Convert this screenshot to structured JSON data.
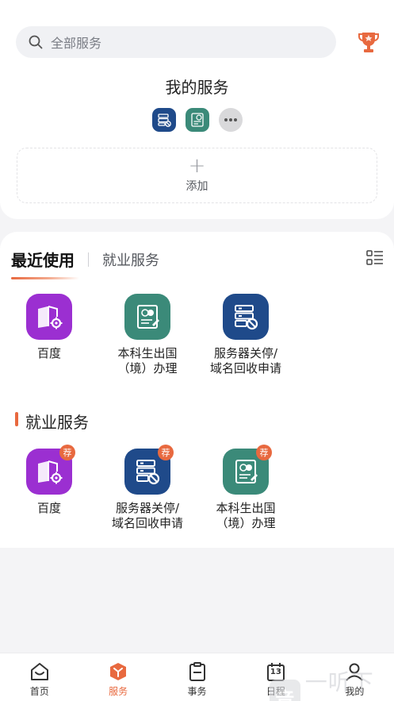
{
  "search": {
    "placeholder": "全部服务"
  },
  "my_services": {
    "title": "我的服务",
    "icons": [
      "server-stop-icon",
      "certificate-icon",
      "more-icon"
    ]
  },
  "add": {
    "plus": "+",
    "label": "添加"
  },
  "tabs": {
    "active": "最近使用",
    "other": "就业服务"
  },
  "recent": [
    {
      "name": "百度",
      "icon": "book-gear-icon",
      "color": "#9b2fd1"
    },
    {
      "name": "本科生出国\n（境）办理",
      "icon": "certificate-icon",
      "color": "#3b8a79"
    },
    {
      "name": "服务器关停/\n域名回收申请",
      "icon": "server-stop-icon",
      "color": "#1f4a8a"
    }
  ],
  "employment": {
    "title": "就业服务",
    "badge": "荐",
    "items": [
      {
        "name": "百度",
        "icon": "book-gear-icon",
        "color": "#9b2fd1"
      },
      {
        "name": "服务器关停/\n域名回收申请",
        "icon": "server-stop-icon",
        "color": "#1f4a8a"
      },
      {
        "name": "本科生出国\n（境）办理",
        "icon": "certificate-icon",
        "color": "#3b8a79"
      }
    ]
  },
  "nav": [
    {
      "label": "首页",
      "icon": "home-icon"
    },
    {
      "label": "服务",
      "icon": "service-cube-icon",
      "active": true
    },
    {
      "label": "事务",
      "icon": "clipboard-icon"
    },
    {
      "label": "日程",
      "icon": "calendar-icon",
      "day": "13"
    },
    {
      "label": "我的",
      "icon": "user-icon"
    }
  ],
  "watermark": {
    "mark": "音",
    "text": "一听下载"
  },
  "colors": {
    "accent": "#e8693f",
    "purple": "#9b2fd1",
    "teal": "#3b8a79",
    "navy": "#1f4a8a"
  }
}
